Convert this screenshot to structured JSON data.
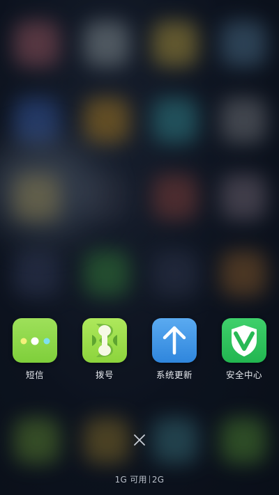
{
  "recent_apps": [
    {
      "label": "短信",
      "icon": "sms-icon"
    },
    {
      "label": "拨号",
      "icon": "dialer-icon"
    },
    {
      "label": "系统更新",
      "icon": "system-update-icon"
    },
    {
      "label": "安全中心",
      "icon": "security-center-icon"
    }
  ],
  "controls": {
    "close_icon": "close-icon"
  },
  "memory": {
    "available": "1G 可用",
    "total": "2G"
  },
  "colors": {
    "sms": "#8ed84a",
    "dialer": "#9ade4c",
    "update": "#3f95e6",
    "security": "#2dc25c"
  }
}
